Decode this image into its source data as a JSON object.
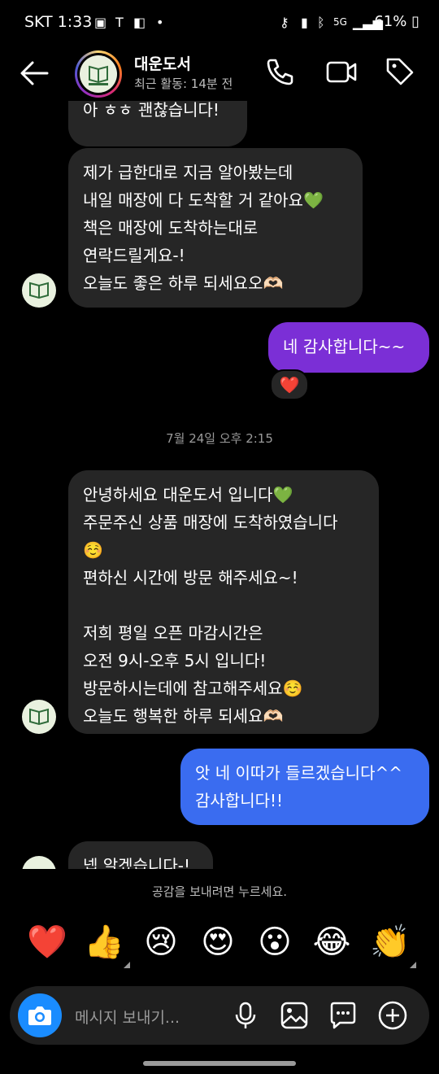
{
  "status_bar": {
    "time": "SKT 1:33",
    "battery": "61%",
    "icons": [
      "gallery-icon",
      "tesla-icon",
      "shopping-bag-icon",
      "dot-icon",
      "key-icon",
      "battery-saver-icon",
      "bluetooth-icon",
      "5g-icon",
      "signal-icon",
      "battery-icon"
    ]
  },
  "header": {
    "contact_name": "대운도서",
    "status": "최근 활동: 14분 전",
    "icons": [
      "back-arrow-icon",
      "phone-icon",
      "video-icon",
      "tag-icon"
    ]
  },
  "messages": [
    {
      "side": "in",
      "lines": [
        "아 ㅎㅎ 괜찮습니다!"
      ]
    },
    {
      "side": "in",
      "lines": [
        "제가 급한대로 지금 알아봤는데",
        "내일 매장에 다 도착할 거 같아요💚",
        "책은 매장에 도착하는대로",
        "연락드릴게요-!",
        "오늘도 좋은 하루 되세요오🫶🏻"
      ]
    },
    {
      "side": "out",
      "lines": [
        "네 감사합니다~~"
      ],
      "reaction": "❤️"
    },
    {
      "side": "in",
      "lines": [
        "안녕하세요 대운도서 입니다💚",
        "주문주신 상품 매장에 도착하였습니다",
        "☺️",
        "편하신 시간에 방문 해주세요~!",
        "",
        "저희 평일 오픈 마감시간은",
        "오전 9시-오후 5시 입니다!",
        "방문하시는데에 참고해주세요☺️",
        "오늘도 행복한 하루 되세요🫶🏻"
      ]
    },
    {
      "side": "out",
      "lines": [
        "앗 네 이따가 들르겠습니다^^",
        "감사합니다!!"
      ]
    },
    {
      "side": "in",
      "lines": [
        "넵 알겠습니다-!"
      ]
    }
  ],
  "date_separator": "7월 24일 오후 2:15",
  "reaction_hint": "공감을 보내려면 누르세요.",
  "quick_reactions": [
    "❤️",
    "👍",
    "😢",
    "😍",
    "😮",
    "😂",
    "👏"
  ],
  "composer": {
    "placeholder": "메시지 보내기...",
    "icons": [
      "camera-icon",
      "microphone-icon",
      "gallery-icon",
      "sticker-icon",
      "plus-icon"
    ]
  },
  "colors": {
    "incoming_bubble": "#262626",
    "outgoing_purple": "#7b2fd6",
    "outgoing_blue": "#3a6cf0",
    "camera_button": "#1a8cff"
  }
}
